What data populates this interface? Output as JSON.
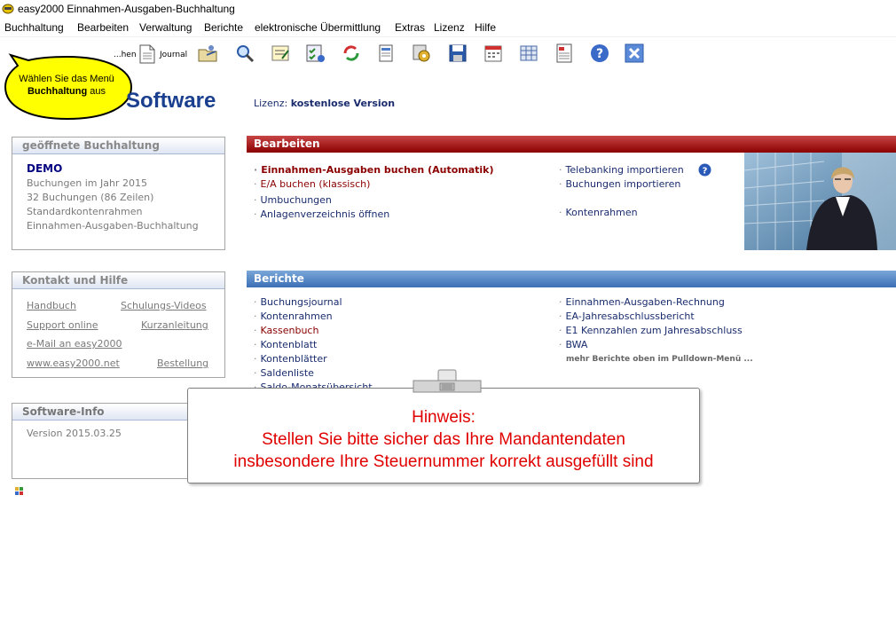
{
  "window": {
    "title": "easy2000 Einnahmen-Ausgaben-Buchhaltung"
  },
  "menu": [
    "Buchhaltung",
    "Bearbeiten",
    "Verwaltung",
    "Berichte",
    "elektronische Übermittlung",
    "Extras",
    "Lizenz",
    "Hilfe"
  ],
  "toolbar": {
    "partial_label": "...hen",
    "journal_label": "Journal"
  },
  "balloon": {
    "line1": "Wählen Sie das Menü",
    "line2_bold": "Buchhaltung",
    "line2_rest": " aus"
  },
  "header": {
    "logo_text": "Software",
    "license_label": "Lizenz:",
    "license_value": "kostenlose Version"
  },
  "open_book": {
    "title": "geöffnete Buchhaltung",
    "name": "DEMO",
    "lines": [
      "Buchungen im Jahr 2015",
      "32 Buchungen (86 Zeilen)",
      "Standardkontenrahmen",
      "Einnahmen-Ausgaben-Buchhaltung"
    ]
  },
  "contact": {
    "title": "Kontakt und Hilfe",
    "links": [
      "Handbuch",
      "Schulungs-Videos",
      "Support online",
      "Kurzanleitung",
      "e-Mail an easy2000",
      "www.easy2000.net",
      "Bestellung"
    ]
  },
  "software_info": {
    "title": "Software-Info",
    "version": "Version 2015.03.25"
  },
  "bearbeiten": {
    "title": "Bearbeiten",
    "left": [
      "Einnahmen-Ausgaben buchen (Automatik)",
      "E/A buchen (klassisch)",
      "Umbuchungen",
      "Anlagenverzeichnis öffnen"
    ],
    "right": [
      "Telebanking importieren",
      "Buchungen importieren",
      "Kontenrahmen"
    ]
  },
  "berichte": {
    "title": "Berichte",
    "left": [
      "Buchungsjournal",
      "Kontenrahmen",
      "Kassenbuch",
      "Kontenblatt",
      "Kontenblätter",
      "Saldenliste",
      "Saldo-Monatsübersicht"
    ],
    "right": [
      "Einnahmen-Ausgaben-Rechnung",
      "EA-Jahresabschlussbericht",
      "E1 Kennzahlen zum Jahresabschluss",
      "BWA"
    ],
    "more": "mehr Berichte oben im Pulldown-Menü ..."
  },
  "hint": {
    "line1": "Hinweis:",
    "line2": "Stellen Sie bitte sicher das Ihre Mandantendaten",
    "line3": "insbesondere Ihre Steuernummer korrekt ausgefüllt sind"
  },
  "colors": {
    "section_red": "#8b0000",
    "section_blue": "#3c6fb6",
    "link_navy": "#1a2c6e",
    "hint_red": "#e00000",
    "balloon_yellow": "#ffff00"
  }
}
